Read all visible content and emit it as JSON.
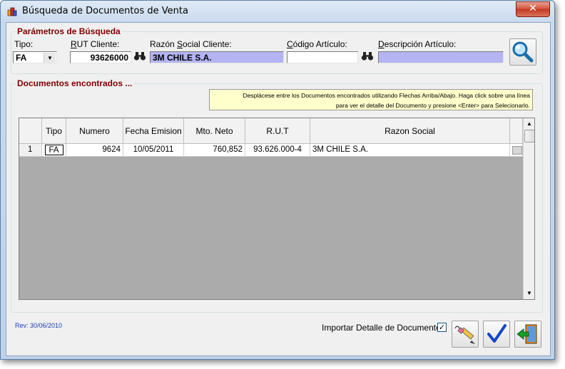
{
  "window": {
    "title": "Búsqueda de Documentos de Venta",
    "close_label": "✕"
  },
  "params": {
    "group_title": "Parámetros de Búsqueda",
    "tipo": {
      "label": "Tipo:",
      "value": "FA"
    },
    "rut": {
      "label_prefix": "R",
      "label_rest": "UT Cliente:",
      "value": "93626000"
    },
    "razon": {
      "label_prefix": "Razón ",
      "label_u": "S",
      "label_rest": "ocial Cliente:",
      "value": "3M CHILE S.A."
    },
    "codigo": {
      "label_prefix": "",
      "label_u": "C",
      "label_rest": "ódigo Artículo:",
      "value": ""
    },
    "descripcion": {
      "label_prefix": "",
      "label_u": "D",
      "label_rest": "escripción Artículo:",
      "value": ""
    }
  },
  "results": {
    "group_title": "Documentos encontrados ...",
    "hint_line1": "Desplácese entre los Documentos encontrados utilizando Flechas Arriba/Abajo. Haga click sobre una línea",
    "hint_line2": "para ver el detalle del Documento y presione <Enter> para Selecionarlo.",
    "columns": [
      "",
      "Tipo",
      "Numero",
      "Fecha Emision",
      "Mto. Neto",
      "R.U.T",
      "Razon Social"
    ],
    "rows": [
      {
        "index": "1",
        "tipo": "FA",
        "numero": "9624",
        "fecha": "10/05/2011",
        "neto": "760,852",
        "rut": "93.626.000-4",
        "razon": "3M CHILE S.A."
      }
    ]
  },
  "footer": {
    "rev": "Rev: 30/06/2010",
    "import_label": "Importar Detalle de Documentos",
    "import_checked": "✓"
  },
  "colors": {
    "accent_title": "#800000",
    "readonly_field": "#b4b4f3",
    "hint_bg": "#ffffcc",
    "rev_text": "#1f3fb0"
  }
}
